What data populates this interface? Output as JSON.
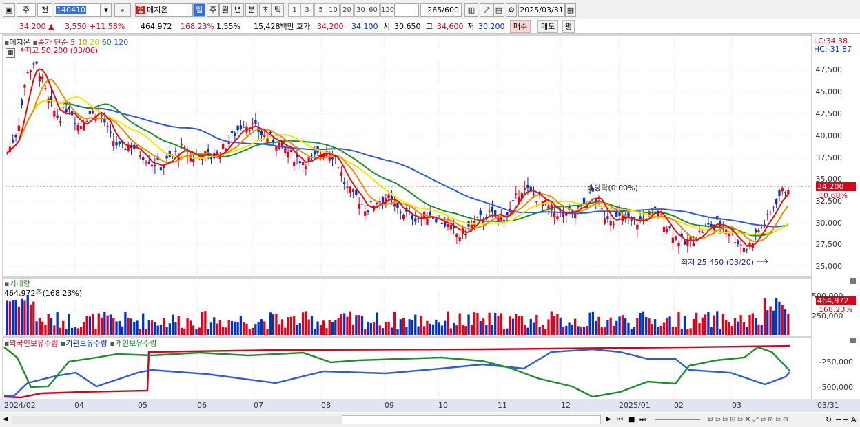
{
  "toolbar": {
    "type_label": "주",
    "prev_label": "전",
    "code": "140410",
    "stock_name_badge": "종",
    "stock_name": "메지온",
    "periods": [
      "일",
      "주",
      "월",
      "년",
      "분",
      "초",
      "틱"
    ],
    "active_period": "일",
    "intervals": [
      "1",
      "3",
      "5",
      "10",
      "20",
      "30",
      "60",
      "120"
    ],
    "count": "265",
    "count_total": "/600",
    "date": "2025/03/31"
  },
  "quote": {
    "price": "34,200",
    "change_arrow": "▲",
    "change": "3,550",
    "change_pct": "+11.58%",
    "volume": "464,972",
    "volume_ratio": "168.23%",
    "turnover": "1.55%",
    "amount": "15,428백만",
    "ask_label": "호가",
    "ask": "34,200",
    "bid": "34,100",
    "open_label": "시",
    "open": "30,650",
    "high_label": "고",
    "high": "34,600",
    "low_label": "저",
    "low": "30,200",
    "buy_label": "매수",
    "sell_label": "매도",
    "avg_label": "평"
  },
  "price_panel": {
    "legend_name": "메지온",
    "legend_ma_title": "종가 단순",
    "ma_periods": [
      "5",
      "10",
      "20",
      "60",
      "120"
    ],
    "ma_colors": {
      "5": "#e01010",
      "10": "#f08a00",
      "20": "#f5e600",
      "60": "#1e8c2e",
      "120": "#2f5bd8"
    },
    "high_annotation": "최고 50,200 (03/06)",
    "low_annotation": "최저 25,450 (03/20)",
    "dividend_annotation": "배당락(0.00%)",
    "lc_label": "LC:34.38",
    "hc_label": "HC:-31.87",
    "current_price_tag": "34,200",
    "current_pct_tag": "10.68%",
    "y_ticks": [
      "47,500",
      "45,000",
      "42,500",
      "40,000",
      "37,500",
      "35,000",
      "32,500",
      "30,000",
      "27,500",
      "25,000"
    ]
  },
  "volume_panel": {
    "title": "거래량",
    "value_text": "464,972주(168.23%)",
    "value_tag": "464,972",
    "pct_tag": "168.23%",
    "y_ticks": [
      "500,000",
      "250,000"
    ]
  },
  "holding_panel": {
    "legend": [
      "외국인보유수량",
      "기관보유수량",
      "개인보유수량"
    ],
    "y_ticks": [
      "-250,000",
      "-500,000"
    ]
  },
  "x_axis": [
    "2024/02",
    "04",
    "05",
    "06",
    "07",
    "08",
    "09",
    "10",
    "11",
    "12",
    "2025/01",
    "02",
    "03",
    "03/31"
  ],
  "chart_data": {
    "type": "line",
    "title": "",
    "y_range": [
      24000,
      50200
    ],
    "close_path": [
      38000,
      40500,
      47500,
      48000,
      44000,
      42000,
      43500,
      41000,
      42500,
      43000,
      40000,
      38500,
      39000,
      38000,
      37000,
      36500,
      37500,
      38500,
      37500,
      38000,
      37500,
      38500,
      40000,
      41500,
      41000,
      40000,
      39500,
      38500,
      37500,
      37000,
      37500,
      38500,
      37500,
      34000,
      33000,
      31500,
      32500,
      33000,
      31500,
      31000,
      30500,
      31000,
      30500,
      29500,
      28500,
      29500,
      30500,
      31000,
      30500,
      31500,
      34000,
      33500,
      32500,
      31500,
      31000,
      31000,
      32000,
      33500,
      31000,
      30500,
      30500,
      30000,
      30500,
      31500,
      30000,
      28500,
      27500,
      28500,
      29500,
      30000,
      29500,
      28000,
      27000,
      29000,
      30500,
      33000,
      34200
    ],
    "highest": {
      "value": 50200,
      "date": "03/06"
    },
    "lowest": {
      "value": 25450,
      "date": "03/20"
    },
    "current": 34200
  },
  "statusbar": {
    "icons": [
      "scroll-left-icon",
      "scroll-right-icon",
      "first-icon",
      "stop-icon",
      "last-icon",
      "zoom-slider-icon",
      "layout-icon",
      "zoom-out-icon",
      "zoom-in-icon",
      "font-icon"
    ]
  }
}
